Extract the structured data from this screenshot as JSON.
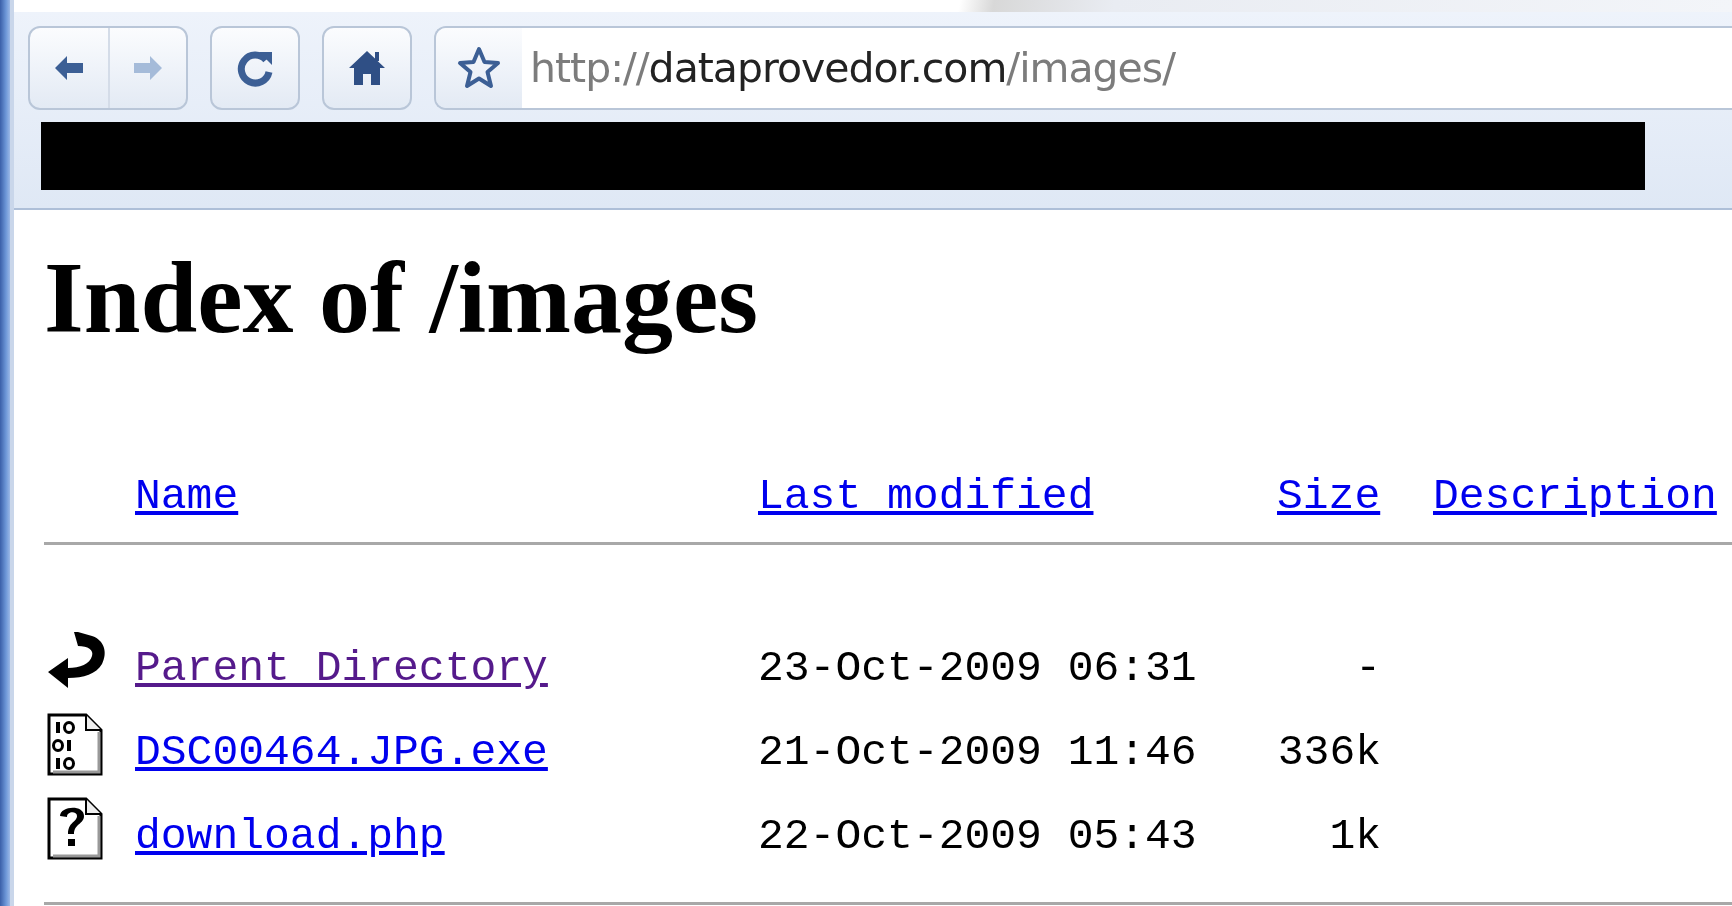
{
  "address_bar": {
    "scheme": "http://",
    "host": "dataprovedor.com",
    "path": "/images/"
  },
  "heading": "Index of /images",
  "columns": [
    "Name",
    "Last modified",
    "Size",
    "Description"
  ],
  "rows": [
    {
      "kind": "parent",
      "name": "Parent Directory",
      "visited": true,
      "modified": "23-Oct-2009 06:31",
      "size": "-"
    },
    {
      "kind": "binary",
      "name": "DSC00464.JPG.exe",
      "visited": false,
      "modified": "21-Oct-2009 11:46",
      "size": "336k"
    },
    {
      "kind": "unknown",
      "name": "download.php",
      "visited": false,
      "modified": "22-Oct-2009 05:43",
      "size": "1k"
    }
  ]
}
